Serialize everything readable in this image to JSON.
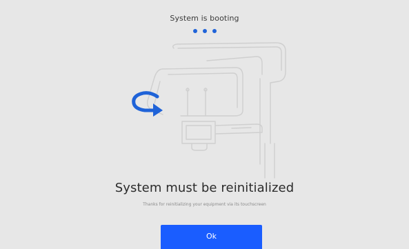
{
  "status": {
    "text": "System is booting",
    "dots": 3,
    "dot_color": "#1f63d8"
  },
  "illustration": {
    "icon": "rotate-arrow-icon",
    "arrow_color": "#1f63d8",
    "device": "dental-imaging-unit-outline"
  },
  "message": {
    "title": "System must be reinitialized",
    "subtitle": "Thanks for reinitializing your equipment via its touchscreen"
  },
  "actions": {
    "ok_label": "Ok",
    "ok_color": "#1a5dff"
  },
  "colors": {
    "background": "#e7e7e7"
  }
}
